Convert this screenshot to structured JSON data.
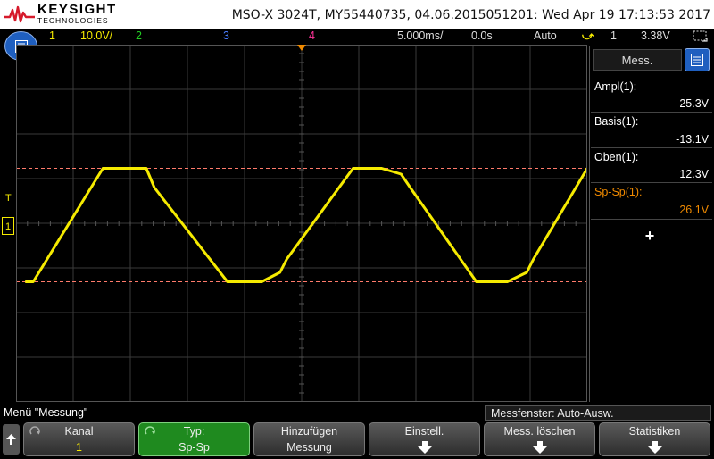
{
  "header": {
    "brand": "KEYSIGHT",
    "brand_tagline": "TECHNOLOGIES",
    "instrument_info": "MSO-X 3024T, MY55440735, 04.06.2015051201: Wed Apr 19 17:13:53 2017"
  },
  "status": {
    "ch1_label": "1",
    "ch1_scale": "10.0V/",
    "ch2_label": "2",
    "ch3_label": "3",
    "ch4_label": "4",
    "timebase": "5.000ms/",
    "delay": "0.0s",
    "trigger_mode": "Auto",
    "trigger_source": "1",
    "trigger_level": "3.38V",
    "colors": {
      "ch1": "#f5ea00",
      "ch2": "#22cc22",
      "ch3": "#4a7dff",
      "ch4": "#ff3399",
      "accent": "#f08a00"
    }
  },
  "chart_data": {
    "type": "line",
    "title": "",
    "xlabel": "",
    "ylabel": "",
    "x_unit": "ms",
    "y_unit": "V",
    "xlim": [
      -25,
      25
    ],
    "ylim": [
      -40,
      40
    ],
    "grid": true,
    "series": [
      {
        "name": "1",
        "color": "#f5ea00",
        "x": [
          -24.2,
          -23.5,
          -17.4,
          -15.0,
          -13.6,
          -12.9,
          -6.5,
          -3.5,
          -1.9,
          -1.3,
          4.5,
          7.0,
          8.7,
          9.5,
          15.3,
          18.0,
          19.7,
          20.3,
          25.0
        ],
        "y": [
          -13.1,
          -13.1,
          12.3,
          12.3,
          12.3,
          8.0,
          -13.1,
          -13.1,
          -11.0,
          -8.0,
          12.3,
          12.3,
          11.0,
          8.0,
          -13.1,
          -13.1,
          -11.0,
          -8.0,
          12.3
        ]
      }
    ],
    "markers": {
      "upper": 12.3,
      "lower": -13.1
    }
  },
  "panel": {
    "tab_label": "Mess.",
    "measurements": [
      {
        "label": "Ampl(1):",
        "value": "25.3V",
        "highlight": false
      },
      {
        "label": "Basis(1):",
        "value": "-13.1V",
        "highlight": false
      },
      {
        "label": "Oben(1):",
        "value": "12.3V",
        "highlight": false
      },
      {
        "label": "Sp-Sp(1):",
        "value": "26.1V",
        "highlight": true
      }
    ],
    "add_label": "+"
  },
  "menu": {
    "title": "Menü \"Messung\"",
    "window_status": "Messfenster: Auto-Ausw.",
    "softkeys": [
      {
        "l1": "Kanal",
        "l2": "1"
      },
      {
        "l1": "Typ:",
        "l2": "Sp-Sp"
      },
      {
        "l1": "Hinzufügen",
        "l2": "Messung"
      },
      {
        "l1": "Einstell.",
        "l2": ""
      },
      {
        "l1": "Mess. löschen",
        "l2": ""
      },
      {
        "l1": "Statistiken",
        "l2": ""
      }
    ]
  }
}
